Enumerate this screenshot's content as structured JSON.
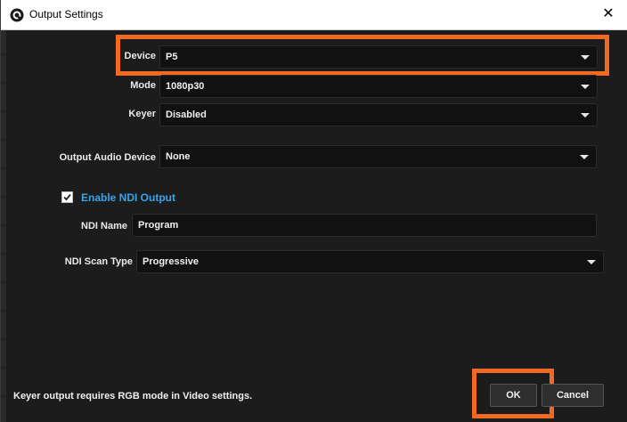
{
  "window": {
    "title": "Output Settings"
  },
  "form": {
    "device": {
      "label": "Device",
      "value": "P5"
    },
    "mode": {
      "label": "Mode",
      "value": "1080p30"
    },
    "keyer": {
      "label": "Keyer",
      "value": "Disabled"
    },
    "output_audio_device": {
      "label": "Output Audio Device",
      "value": "None"
    },
    "enable_ndi": {
      "label": "Enable NDI Output",
      "checked": true
    },
    "ndi_name": {
      "label": "NDI Name",
      "value": "Program"
    },
    "ndi_scan_type": {
      "label": "NDI Scan Type",
      "value": "Progressive"
    }
  },
  "footer": {
    "note": "Keyer output requires RGB mode in Video settings.",
    "ok_label": "OK",
    "cancel_label": "Cancel"
  },
  "colors": {
    "highlight": "#f26a21",
    "ndi_label": "#3aa3ea",
    "background": "#1c1c1c"
  },
  "icons": {
    "app": "app-logo-icon",
    "close": "close-icon",
    "dropdown": "chevron-down-icon",
    "check": "checkmark-icon"
  }
}
